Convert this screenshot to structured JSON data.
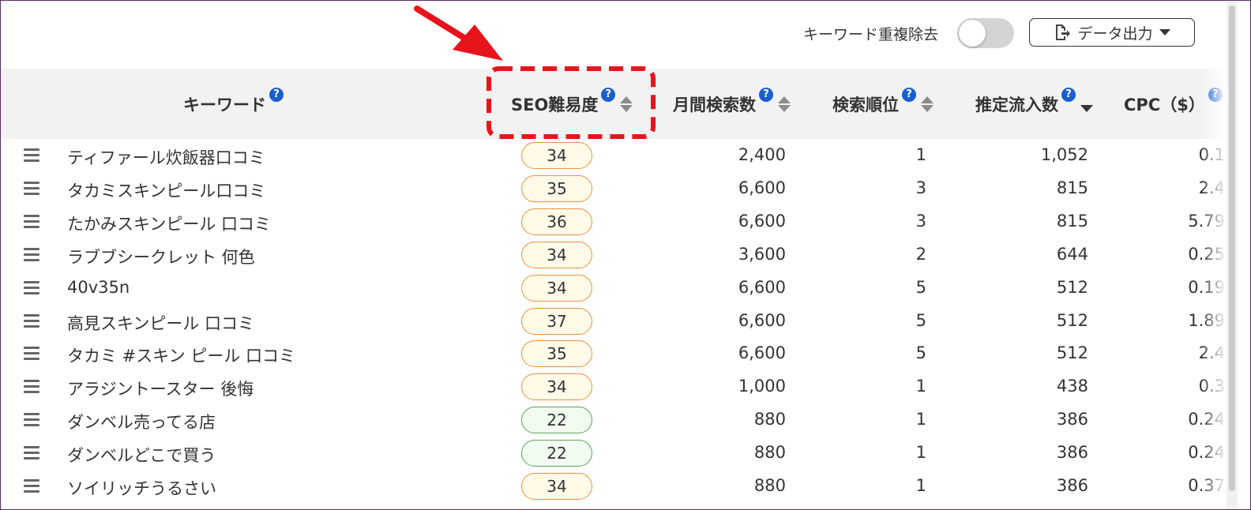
{
  "toolbar": {
    "dedupe_label": "キーワード重複除去",
    "dedupe_on": false,
    "export_label": "データ出力"
  },
  "columns": {
    "keyword": "キーワード",
    "seo": "SEO難易度",
    "volume": "月間検索数",
    "rank": "検索順位",
    "traffic": "推定流入数",
    "cpc": "CPC（$）",
    "help_glyph": "?"
  },
  "sorted_by": "traffic",
  "sort_direction": "desc",
  "difficulty_colors": {
    "medium_border": "#ec8f3e",
    "medium_fill": "#fffbe8",
    "low_border": "#58a35b",
    "low_fill": "#f1fbef"
  },
  "highlight_color": "#e8141c",
  "rows": [
    {
      "keyword": "ティファール炊飯器口コミ",
      "seo": "34",
      "level": "med",
      "volume": "2,400",
      "rank": "1",
      "traffic": "1,052",
      "cpc": "0.1"
    },
    {
      "keyword": "タカミスキンピール口コミ",
      "seo": "35",
      "level": "med",
      "volume": "6,600",
      "rank": "3",
      "traffic": "815",
      "cpc": "2.4"
    },
    {
      "keyword": "たかみスキンピール 口コミ",
      "seo": "36",
      "level": "med",
      "volume": "6,600",
      "rank": "3",
      "traffic": "815",
      "cpc": "5.79"
    },
    {
      "keyword": "ラブブシークレット 何色",
      "seo": "34",
      "level": "med",
      "volume": "3,600",
      "rank": "2",
      "traffic": "644",
      "cpc": "0.25"
    },
    {
      "keyword": "40v35n",
      "seo": "34",
      "level": "med",
      "volume": "6,600",
      "rank": "5",
      "traffic": "512",
      "cpc": "0.19"
    },
    {
      "keyword": "高見スキンピール 口コミ",
      "seo": "37",
      "level": "med",
      "volume": "6,600",
      "rank": "5",
      "traffic": "512",
      "cpc": "1.89"
    },
    {
      "keyword": "タカミ #スキン ピール 口コミ",
      "seo": "35",
      "level": "med",
      "volume": "6,600",
      "rank": "5",
      "traffic": "512",
      "cpc": "2.4"
    },
    {
      "keyword": "アラジントースター 後悔",
      "seo": "34",
      "level": "med",
      "volume": "1,000",
      "rank": "1",
      "traffic": "438",
      "cpc": "0.3"
    },
    {
      "keyword": "ダンベル売ってる店",
      "seo": "22",
      "level": "low",
      "volume": "880",
      "rank": "1",
      "traffic": "386",
      "cpc": "0.24"
    },
    {
      "keyword": "ダンベルどこで買う",
      "seo": "22",
      "level": "low",
      "volume": "880",
      "rank": "1",
      "traffic": "386",
      "cpc": "0.24"
    },
    {
      "keyword": "ソイリッチうるさい",
      "seo": "34",
      "level": "med",
      "volume": "880",
      "rank": "1",
      "traffic": "386",
      "cpc": "0.37"
    }
  ]
}
